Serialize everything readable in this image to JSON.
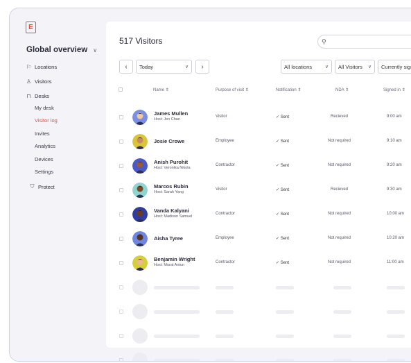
{
  "app": {
    "logo_letter": "E"
  },
  "sidebar": {
    "overview_label": "Global overview",
    "items": [
      {
        "label": "Locations",
        "icon": "map-icon"
      },
      {
        "label": "Visitors",
        "icon": "person-icon"
      },
      {
        "label": "Desks",
        "icon": "desk-icon"
      }
    ],
    "desk_subitems": [
      "My desk",
      "Visitor log",
      "Invites",
      "Analytics",
      "Devices",
      "Settings"
    ],
    "active_subitem": "Visitor log",
    "protect_label": "Protect"
  },
  "main": {
    "title": "517 Visitors",
    "search": {
      "placeholder": ""
    },
    "date_filter": "Today",
    "filters": [
      "All locations",
      "All Visitors",
      "Currently signed in"
    ],
    "columns": [
      "Name",
      "Purpose of visit",
      "Notification",
      "NDA",
      "Signed in"
    ],
    "rows": [
      {
        "name": "James Mullen",
        "host": "Host: Jen Chan",
        "purpose": "Visitor",
        "notification": "Sent",
        "nda": "Recieved",
        "signed_in": "9:00 am",
        "avatar_color": "#7b8fe0",
        "skin": "#f0c8a8"
      },
      {
        "name": "Josie Crowe",
        "host": "",
        "purpose": "Employee",
        "notification": "Sent",
        "nda": "Not required",
        "signed_in": "9:10 am",
        "avatar_color": "#d9c53a",
        "skin": "#c98a62"
      },
      {
        "name": "Anish Purohit",
        "host": "Host: Veronika Nikola",
        "purpose": "Contractor",
        "notification": "Sent",
        "nda": "Not required",
        "signed_in": "9:20 am",
        "avatar_color": "#4a58c8",
        "skin": "#9a5a3a"
      },
      {
        "name": "Marcos Rubin",
        "host": "Host: Sarah Yang",
        "purpose": "Visitor",
        "notification": "Sent",
        "nda": "Recieved",
        "signed_in": "9:30 am",
        "avatar_color": "#8fd4cf",
        "skin": "#7a4a2a"
      },
      {
        "name": "Vanda Kalyani",
        "host": "Host: Madison Samuel",
        "purpose": "Contractor",
        "notification": "Sent",
        "nda": "Not required",
        "signed_in": "10:00 am",
        "avatar_color": "#2f3da0",
        "skin": "#6a3a22"
      },
      {
        "name": "Aisha Tyree",
        "host": "",
        "purpose": "Employee",
        "notification": "Sent",
        "nda": "Not required",
        "signed_in": "10:20 am",
        "avatar_color": "#6f86e0",
        "skin": "#5a3420"
      },
      {
        "name": "Benjamin Wright",
        "host": "Host: Murat Antun",
        "purpose": "Contractor",
        "notification": "Sent",
        "nda": "Not required",
        "signed_in": "11:00 am",
        "avatar_color": "#d5cf3a",
        "skin": "#f0b890"
      }
    ]
  },
  "colors": {
    "accent": "#e84b3c",
    "frame_border": "#c9d3ea",
    "skeleton": "#ececf1"
  },
  "icons": {
    "sent": "check-icon",
    "search": "search-icon",
    "sort": "sort-icon"
  }
}
